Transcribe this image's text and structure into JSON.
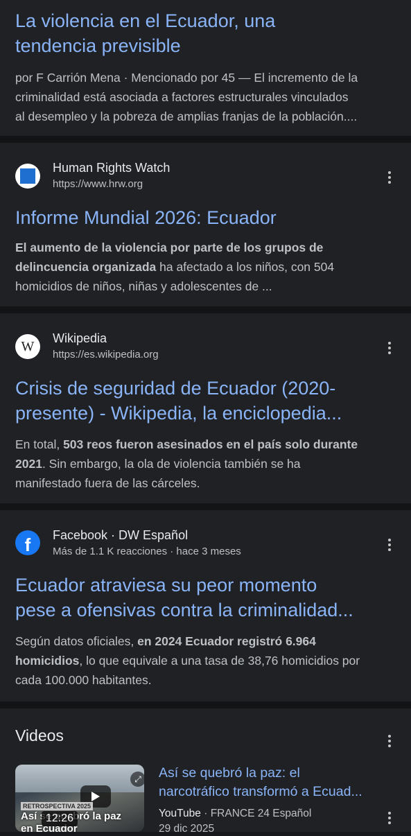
{
  "results": [
    {
      "title_line1": "La violencia en el Ecuador, una",
      "title_line2": "tendencia previsible",
      "snippet_line1": "por F Carrión Mena · Mencionado por 45 — El incremento de la",
      "snippet_line2": "criminalidad está asociada a factores estructurales vinculados",
      "snippet_line3": "al desempleo y la pobreza de amplias franjas de la población...."
    },
    {
      "site": "Human Rights Watch",
      "url": "https://www.hrw.org",
      "favicon_icon": "hrw-blue-square-icon",
      "title_line1": "Informe Mundial 2026: Ecuador",
      "snippet_bold1": "El aumento de la violencia por parte de los grupos de",
      "snippet_bold2": "delincuencia organizada",
      "snippet_rest2": " ha afectado a los niños, con 504",
      "snippet_line3": "homicidios de niños, niñas y adolescentes de ..."
    },
    {
      "site": "Wikipedia",
      "url": "https://es.wikipedia.org",
      "favicon_glyph": "W",
      "title_line1": "Crisis de seguridad de Ecuador (2020-",
      "title_line2": "presente) - Wikipedia, la enciclopedia...",
      "snippet_plain1": "En total, ",
      "snippet_bold1": "503 reos fueron asesinados en el país solo durante",
      "snippet_bold2": "2021",
      "snippet_rest2": ". Sin embargo, la ola de violencia también se ha",
      "snippet_line3": "manifestado fuera de las cárceles."
    },
    {
      "site": "Facebook · DW Español",
      "url": "Más de 1.1 K reacciones · hace 3 meses",
      "favicon_glyph": "f",
      "title_line1": "Ecuador atraviesa su peor momento",
      "title_line2": "pese a ofensivas contra la criminalidad...",
      "snippet_plain1": "Según datos oficiales, ",
      "snippet_bold1": "en 2024 Ecuador registró 6.964",
      "snippet_bold2": "homicidios",
      "snippet_rest2": ", lo que equivale a una tasa de 38,76 homicidios por",
      "snippet_line3": "cada 100.000 habitantes."
    }
  ],
  "videos": {
    "heading": "Videos",
    "items": [
      {
        "title_line1": "Así se quebró la paz: el",
        "title_line2": "narcotráfico transformó a Ecuad...",
        "source": "YouTube",
        "channel": " · FRANCE 24 Español",
        "date": "29 dic 2025",
        "duration": "12:26",
        "badge": "RETROSPECTIVA 2025",
        "caption_line1": "Así se quebró la paz",
        "caption_line2": "en Ecuador"
      }
    ]
  },
  "colors": {
    "background": "#17181c",
    "card": "#202124",
    "link": "#8ab4f8",
    "text": "#bdc1c6"
  }
}
